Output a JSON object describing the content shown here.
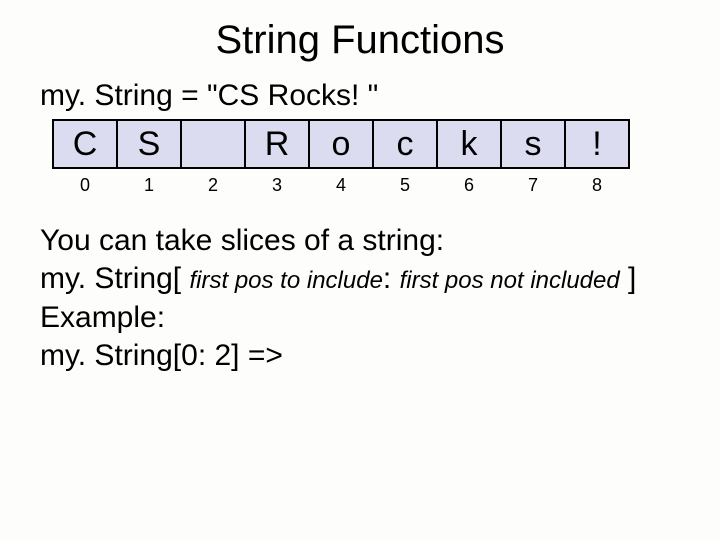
{
  "title": "String Functions",
  "assignment": "my. String = \"CS Rocks! \"",
  "cells": [
    "C",
    "S",
    "",
    "R",
    "o",
    "c",
    "k",
    "s",
    "!"
  ],
  "indices": [
    "0",
    "1",
    "2",
    "3",
    "4",
    "5",
    "6",
    "7",
    "8"
  ],
  "body": {
    "line1": "You can take slices of a string:",
    "line2_prefix": "my. String[ ",
    "line2_italic1": "first pos to include",
    "line2_mid": ": ",
    "line2_italic2": "first pos not included",
    "line2_suffix": " ]",
    "line3": "Example:",
    "line4": "my. String[0: 2] =>"
  }
}
